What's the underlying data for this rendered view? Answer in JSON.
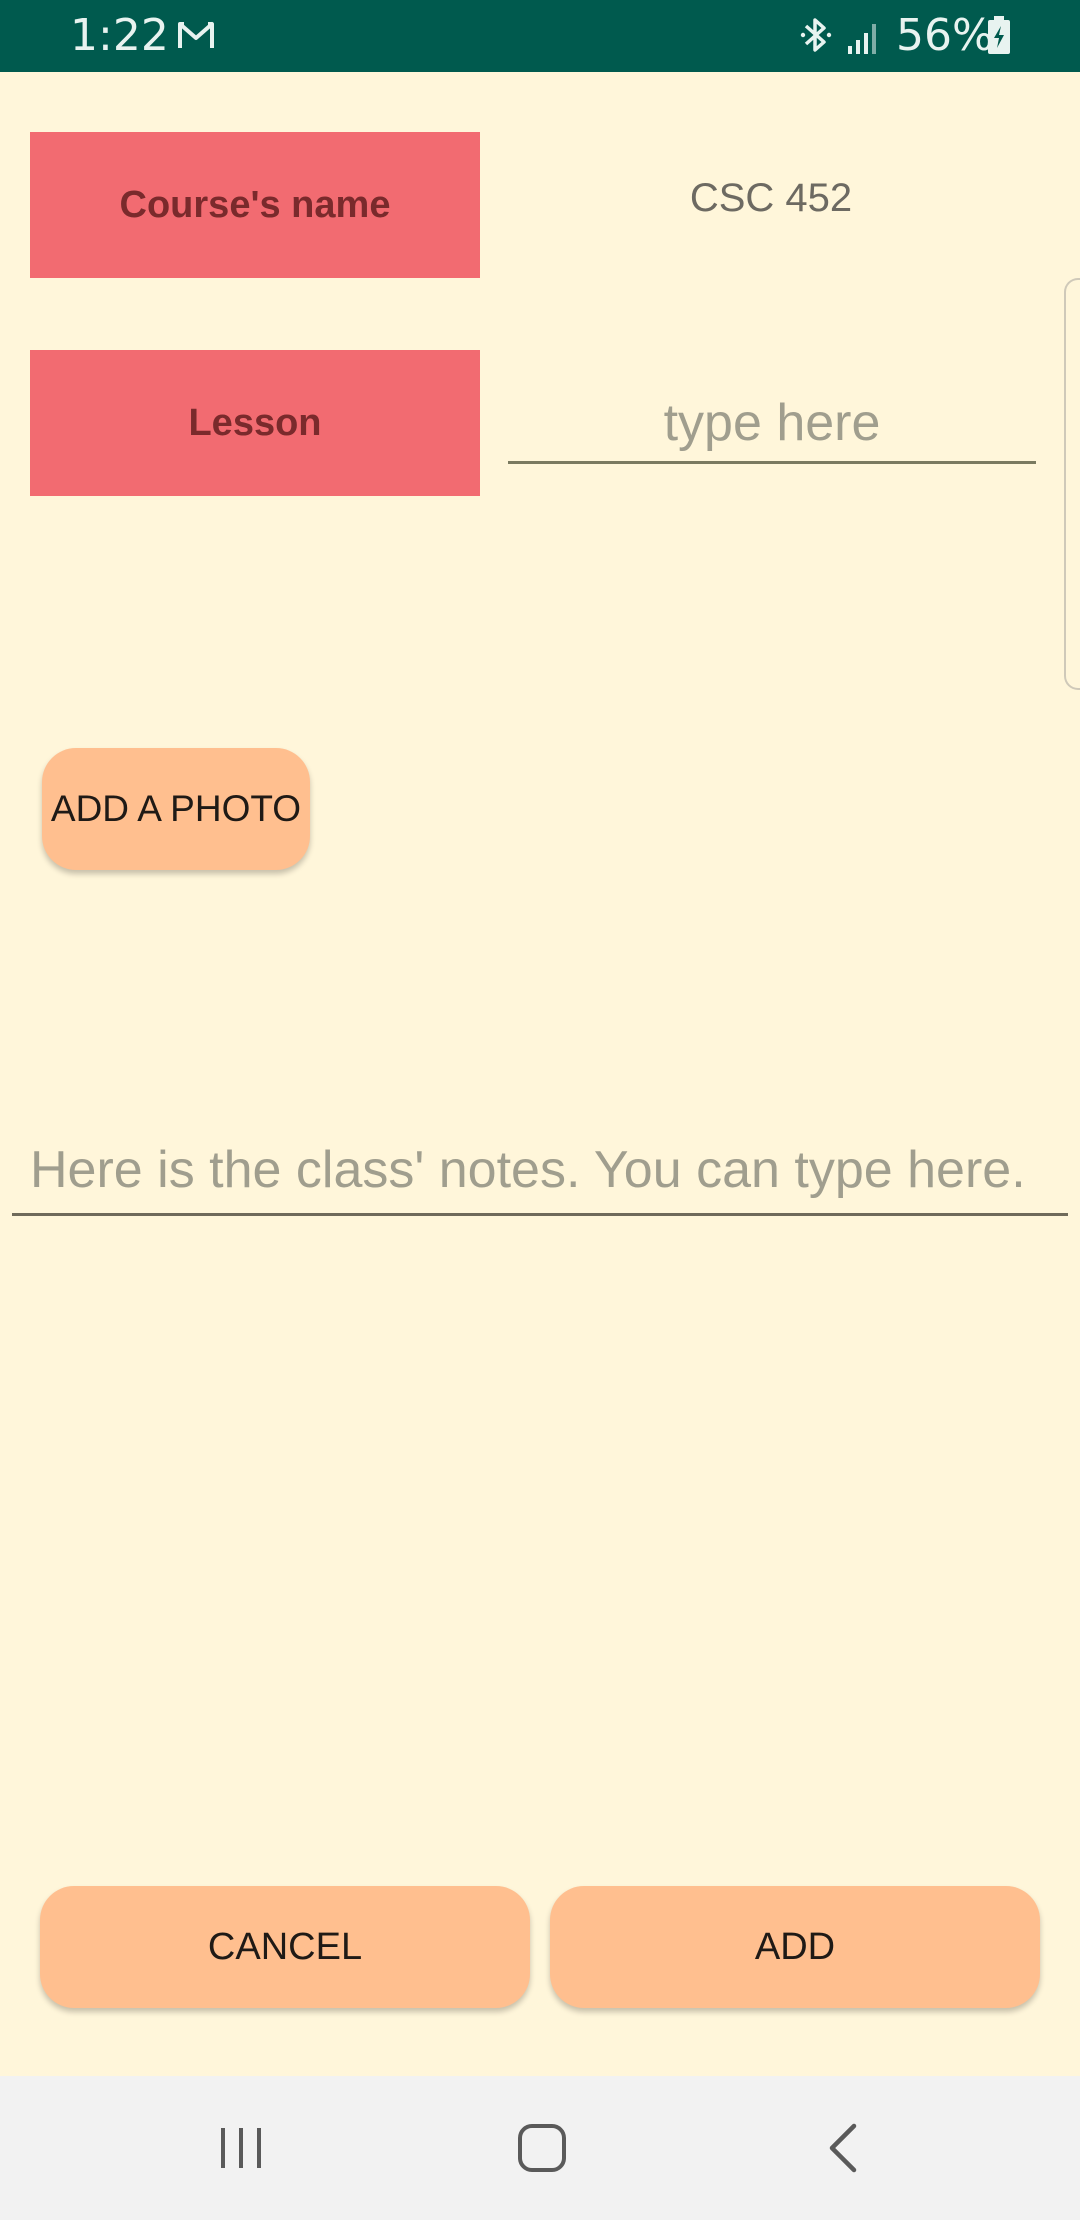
{
  "status_bar": {
    "time": "1:22",
    "battery_percent": "56%",
    "icons": [
      "gmail-icon",
      "bluetooth-icon",
      "signal-icon",
      "battery-charging-icon"
    ],
    "background_color": "#005A4E"
  },
  "form": {
    "course_label": "Course's name",
    "course_value": "CSC 452",
    "lesson_label": "Lesson",
    "lesson_placeholder": "type here",
    "lesson_value": "",
    "photo_button_label": "ADD A PHOTO",
    "notes_placeholder": "Here is the class' notes. You can type here.",
    "notes_value": ""
  },
  "actions": {
    "cancel_label": "CANCEL",
    "add_label": "ADD"
  },
  "navigation": {
    "icons": [
      "recent-apps-icon",
      "home-icon",
      "back-icon"
    ]
  },
  "colors": {
    "background": "#FFF6DA",
    "label_box": "#F26B71",
    "label_text": "#7A2A2C",
    "button": "#FFBF8F",
    "nav_bar": "#F2F2F2"
  }
}
